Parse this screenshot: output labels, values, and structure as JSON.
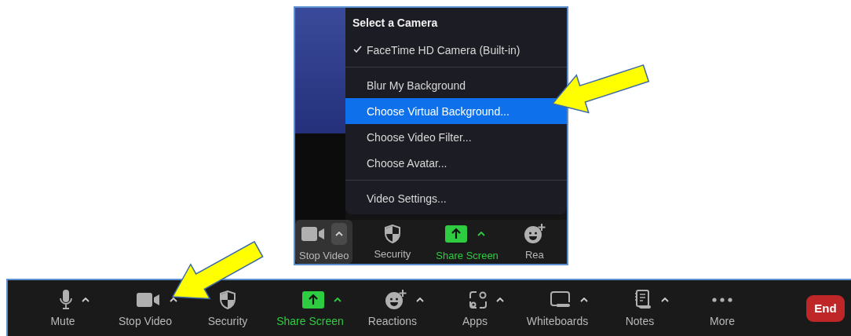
{
  "inset": {
    "menu": {
      "title": "Select a Camera",
      "cameras": [
        {
          "label": "FaceTime HD Camera (Built-in)",
          "checked": true
        }
      ],
      "options": [
        {
          "label": "Blur My Background",
          "selected": false
        },
        {
          "label": "Choose Virtual Background...",
          "selected": true
        },
        {
          "label": "Choose Video Filter...",
          "selected": false
        },
        {
          "label": "Choose Avatar...",
          "selected": false
        }
      ],
      "settings": [
        {
          "label": "Video Settings...",
          "selected": false
        }
      ]
    },
    "toolbar": [
      {
        "label": "Stop Video",
        "kind": "video",
        "caret": true,
        "selected": true,
        "accent": false
      },
      {
        "label": "Security",
        "kind": "shield",
        "caret": false,
        "selected": false,
        "accent": false
      },
      {
        "label": "Share Screen",
        "kind": "share",
        "caret": true,
        "selected": false,
        "accent": true
      },
      {
        "label": "Rea",
        "kind": "smiley",
        "caret": false,
        "selected": false,
        "accent": false
      }
    ]
  },
  "toolbar": {
    "items": [
      {
        "label": "Mute",
        "kind": "mic",
        "caret": true,
        "accent": false
      },
      {
        "label": "Stop Video",
        "kind": "video",
        "caret": true,
        "accent": false
      },
      {
        "label": "Security",
        "kind": "shield",
        "caret": false,
        "accent": false
      },
      {
        "label": "Share Screen",
        "kind": "share",
        "caret": true,
        "accent": true
      },
      {
        "label": "Reactions",
        "kind": "smiley",
        "caret": true,
        "accent": false
      },
      {
        "label": "Apps",
        "kind": "apps",
        "caret": true,
        "accent": false
      },
      {
        "label": "Whiteboards",
        "kind": "whiteboard",
        "caret": true,
        "accent": false
      },
      {
        "label": "Notes",
        "kind": "notes",
        "caret": true,
        "accent": false
      },
      {
        "label": "More",
        "kind": "dots",
        "caret": false,
        "accent": false
      }
    ],
    "end_button": "End"
  }
}
